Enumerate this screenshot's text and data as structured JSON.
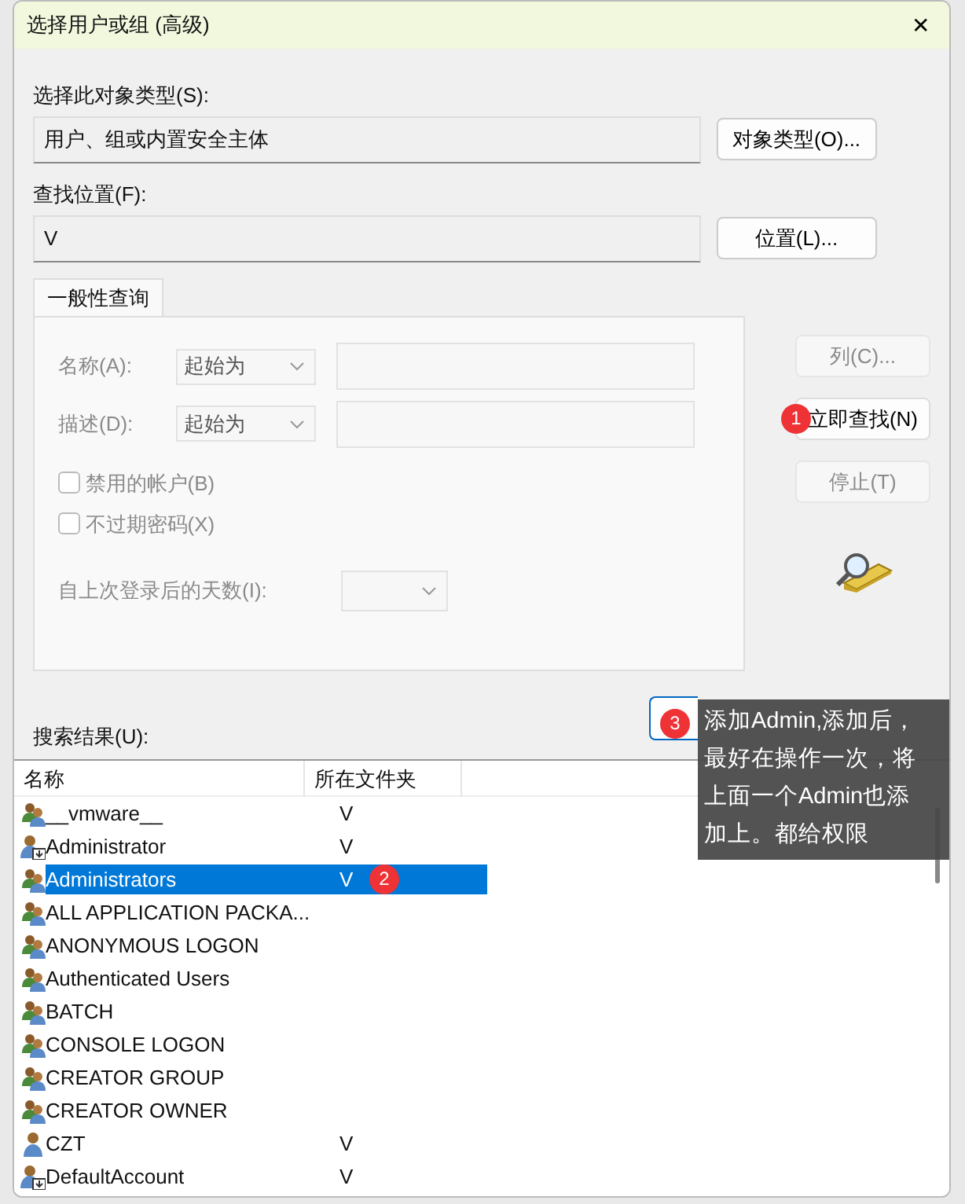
{
  "window": {
    "title": "选择用户或组 (高级)",
    "close": "✕"
  },
  "object_type": {
    "label": "选择此对象类型(S):",
    "value": "用户、组或内置安全主体",
    "button": "对象类型(O)..."
  },
  "location": {
    "label": "查找位置(F):",
    "value": "V",
    "button": "位置(L)..."
  },
  "query_tab": {
    "label": "一般性查询",
    "selected": true
  },
  "query": {
    "disabled": true,
    "rows": [
      {
        "label": "名称(A):",
        "mode": "起始为"
      },
      {
        "label": "描述(D):",
        "mode": "起始为"
      }
    ],
    "checkboxes": [
      {
        "label": "禁用的帐户(B)",
        "checked": false
      },
      {
        "label": "不过期密码(X)",
        "checked": false
      }
    ],
    "days_label": "自上次登录后的天数(I):"
  },
  "side_buttons": [
    {
      "label": "列(C)...",
      "disabled": true
    },
    {
      "label": "立即查找(N)",
      "disabled": false,
      "badge": "1"
    },
    {
      "label": "停止(T)",
      "disabled": true
    }
  ],
  "ok_badge": "3",
  "tooltip": [
    "添加Admin,添加后，",
    "最好在操作一次，将",
    "上面一个Admin也添",
    "加上。都给权限"
  ],
  "results": {
    "label": "搜索结果(U):",
    "columns": [
      "名称",
      "所在文件夹"
    ],
    "rows": [
      {
        "name": "__vmware__",
        "folder": "V",
        "kind": "group",
        "selected": false
      },
      {
        "name": "Administrator",
        "folder": "V",
        "kind": "local-user",
        "selected": false
      },
      {
        "name": "Administrators",
        "folder": "V",
        "kind": "group",
        "selected": true,
        "badge": "2"
      },
      {
        "name": "ALL APPLICATION PACKA...",
        "kind": "group",
        "selected": false
      },
      {
        "name": "ANONYMOUS LOGON",
        "kind": "group",
        "selected": false
      },
      {
        "name": "Authenticated Users",
        "kind": "group",
        "selected": false
      },
      {
        "name": "BATCH",
        "kind": "group",
        "selected": false
      },
      {
        "name": "CONSOLE LOGON",
        "kind": "group",
        "selected": false
      },
      {
        "name": "CREATOR GROUP",
        "kind": "group",
        "selected": false
      },
      {
        "name": "CREATOR OWNER",
        "kind": "group",
        "selected": false
      },
      {
        "name": "CZT",
        "folder": "V",
        "kind": "user",
        "selected": false
      },
      {
        "name": "DefaultAccount",
        "folder": "V",
        "kind": "local-user",
        "selected": false
      }
    ]
  }
}
